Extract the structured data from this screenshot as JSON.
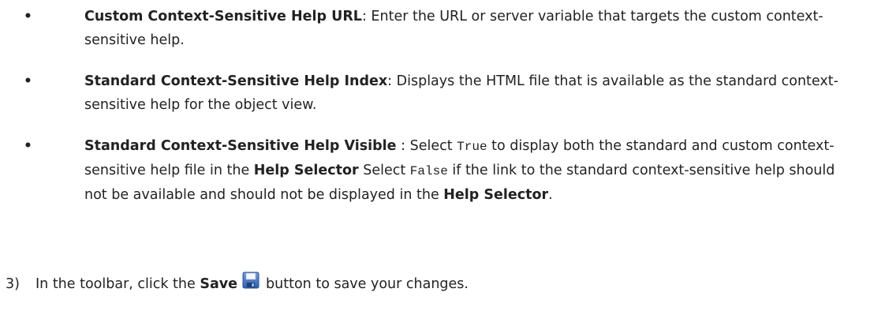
{
  "bullets": [
    {
      "term": "Custom Context-Sensitive Help URL",
      "text": ": Enter the URL or server variable that targets the custom context-sensitive help."
    },
    {
      "term": "Standard Context-Sensitive Help Index",
      "text": ": Displays the HTML file that is available as the standard context-sensitive help for the object view."
    },
    {
      "term": "Standard Context-Sensitive Help Visible",
      "text_1": " : Select ",
      "code_true": "True",
      "text_2": " to display both the standard and custom context-sensitive help file in the ",
      "bold_1": "Help Selector",
      "text_3": " Select ",
      "code_false": "False",
      "text_4": " if the link to the standard context-sensitive help should not be available and should not be displayed in the ",
      "bold_2": "Help Selector",
      "text_5": "."
    }
  ],
  "step": {
    "number": "3)",
    "text_before": "In the toolbar, click the ",
    "bold": "Save",
    "text_after": "button to save your changes.",
    "icon": "save-icon"
  },
  "colors": {
    "text": "#222222",
    "icon_blue": "#3a6fc4"
  }
}
